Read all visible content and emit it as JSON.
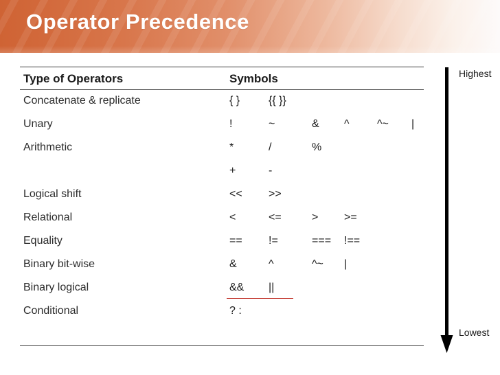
{
  "slide": {
    "title": "Operator Precedence",
    "accent_color": "#cf6334",
    "header_gradient_from": "#cf6334",
    "header_gradient_to": "#fdfafa",
    "background_color": "#ffffff",
    "text_color": "#1a1a1a"
  },
  "table": {
    "headers": {
      "type": "Type of Operators",
      "symbols": "Symbols"
    },
    "rows": [
      {
        "label": "Concatenate & replicate",
        "symbols": [
          "{ }",
          "{{ }}"
        ],
        "highlight": false
      },
      {
        "label": "Unary",
        "symbols": [
          "!",
          "~",
          "&",
          "^",
          "^~",
          "|"
        ],
        "highlight": false
      },
      {
        "label": "Arithmetic",
        "symbols": [
          "*",
          "/",
          "%"
        ],
        "highlight": false
      },
      {
        "label": "",
        "symbols": [
          "+",
          "-"
        ],
        "highlight": false
      },
      {
        "label": "Logical shift",
        "symbols": [
          "<<",
          ">>"
        ],
        "highlight": false
      },
      {
        "label": "Relational",
        "symbols": [
          "<",
          "<=",
          ">",
          ">="
        ],
        "highlight": false
      },
      {
        "label": "Equality",
        "symbols": [
          "==",
          "!=",
          "===",
          "!=="
        ],
        "highlight": false
      },
      {
        "label": "Binary bit-wise",
        "symbols": [
          "&",
          "^",
          "^~",
          "|"
        ],
        "highlight": false
      },
      {
        "label": "Binary logical",
        "symbols": [
          "&&",
          "||"
        ],
        "highlight": true,
        "highlight_color": "#c2352c"
      },
      {
        "label": "Conditional",
        "symbols": [
          "? :"
        ],
        "highlight": false
      }
    ]
  },
  "precedence_arrow": {
    "top_label": "Highest",
    "bottom_label": "Lowest",
    "direction": "down",
    "color": "#000000",
    "icon": "down-arrow-icon"
  }
}
